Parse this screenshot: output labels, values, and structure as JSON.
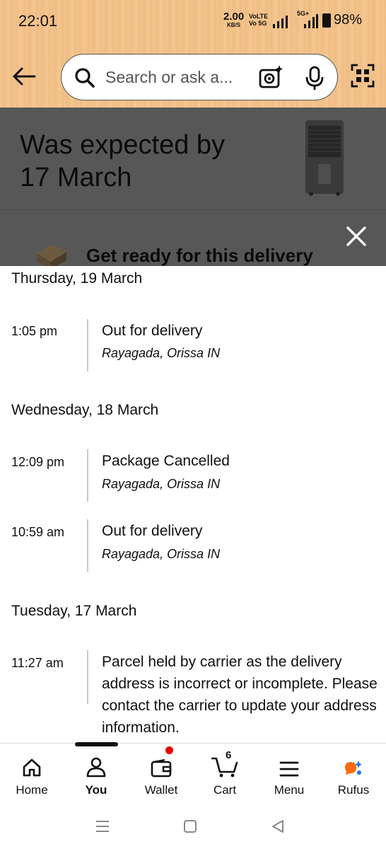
{
  "status_bar": {
    "time": "22:01",
    "speed": "2.00",
    "speed_unit": "KB/S",
    "volte1": "VoLTE",
    "volte2": "Vo 5G",
    "network": "5G+",
    "battery": "98%"
  },
  "header": {
    "search_placeholder": "Search or ask a...",
    "icons": [
      "back-arrow-icon",
      "search-icon",
      "camera-lens-icon",
      "mic-icon",
      "qr-scan-icon"
    ]
  },
  "background": {
    "expected_title": "Was expected by 17 March",
    "ready_text": "Get ready for this delivery"
  },
  "tracking": {
    "days": [
      {
        "heading": "Thursday, 19 March",
        "events": [
          {
            "time": "1:05 pm",
            "status": "Out for delivery",
            "location": "Rayagada, Orissa IN"
          }
        ]
      },
      {
        "heading": "Wednesday, 18 March",
        "events": [
          {
            "time": "12:09 pm",
            "status": "Package Cancelled",
            "location": "Rayagada, Orissa IN"
          },
          {
            "time": "10:59 am",
            "status": "Out for delivery",
            "location": "Rayagada, Orissa IN"
          }
        ]
      },
      {
        "heading": "Tuesday, 17 March",
        "events": [
          {
            "time": "11:27 am",
            "status": "Parcel held by carrier as the delivery address is incorrect or incomplete. Please contact the carrier to update your address information.",
            "location": ""
          }
        ]
      }
    ]
  },
  "bottom_nav": {
    "items": [
      {
        "label": "Home",
        "icon": "home-icon"
      },
      {
        "label": "You",
        "icon": "person-icon",
        "active": true
      },
      {
        "label": "Wallet",
        "icon": "wallet-icon"
      },
      {
        "label": "Cart",
        "icon": "cart-icon",
        "count": "6"
      },
      {
        "label": "Menu",
        "icon": "menu-icon"
      },
      {
        "label": "Rufus",
        "icon": "rufus-icon"
      }
    ]
  },
  "colors": {
    "header_bg": "#f3c48f",
    "overlay": "#575757",
    "notification_dot": "#ee0000",
    "rufus_orange": "#ff6a13",
    "rufus_blue": "#1a73e8"
  }
}
